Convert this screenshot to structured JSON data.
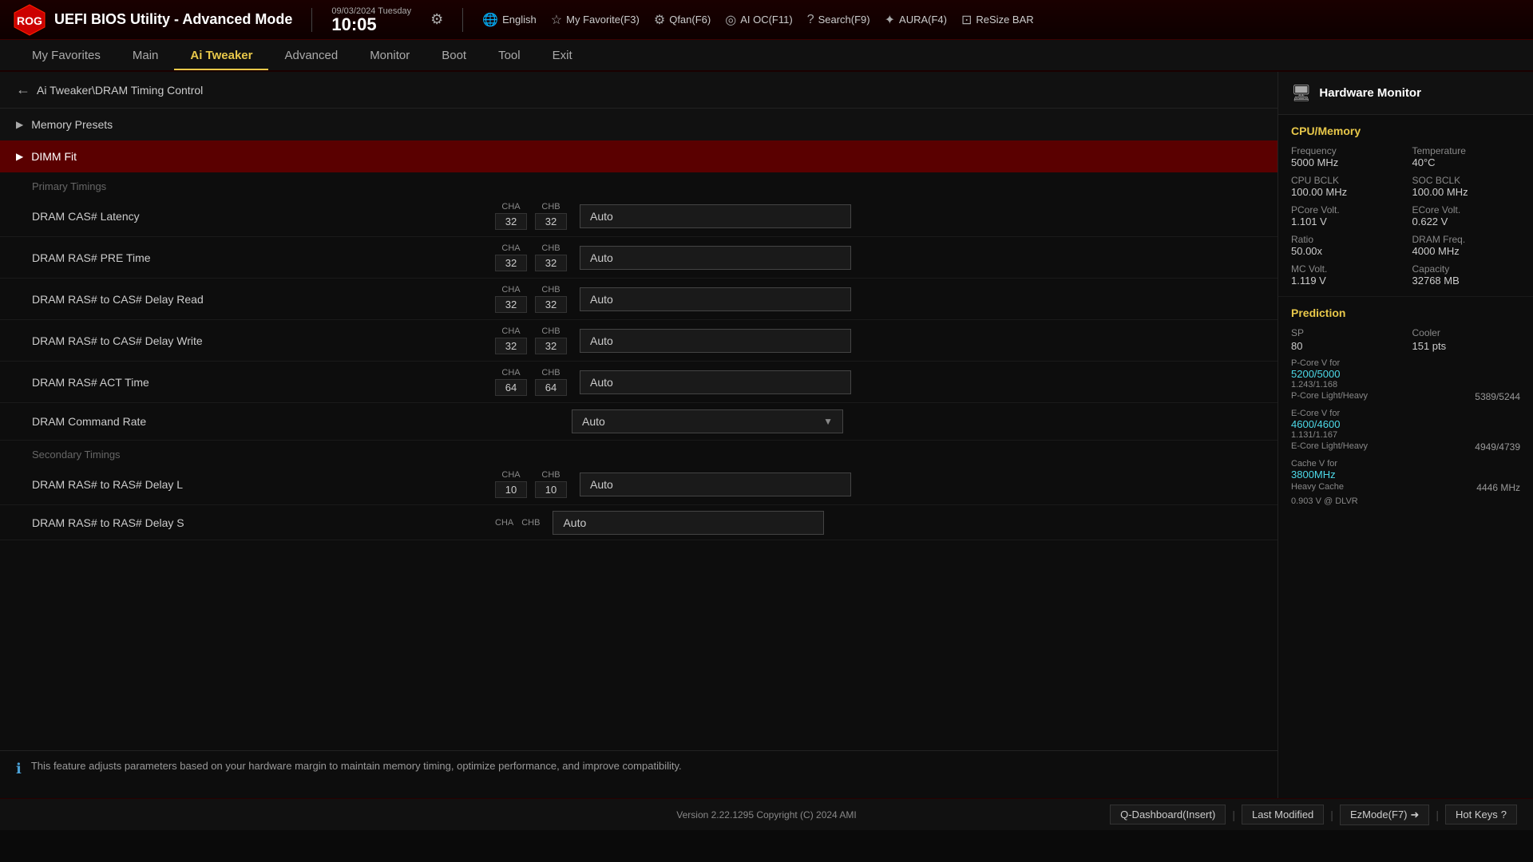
{
  "header": {
    "date": "09/03/2024 Tuesday",
    "time": "10:05",
    "title": "UEFI BIOS Utility - Advanced Mode",
    "tools": [
      {
        "id": "english",
        "icon": "🌐",
        "label": "English"
      },
      {
        "id": "my-favorite",
        "icon": "☆",
        "label": "My Favorite(F3)"
      },
      {
        "id": "qfan",
        "icon": "⚙",
        "label": "Qfan(F6)"
      },
      {
        "id": "ai-oc",
        "icon": "◎",
        "label": "AI OC(F11)"
      },
      {
        "id": "search",
        "icon": "?",
        "label": "Search(F9)"
      },
      {
        "id": "aura",
        "icon": "✦",
        "label": "AURA(F4)"
      },
      {
        "id": "resize-bar",
        "icon": "⊡",
        "label": "ReSize BAR"
      }
    ]
  },
  "nav": {
    "items": [
      {
        "id": "my-favorites",
        "label": "My Favorites",
        "active": false
      },
      {
        "id": "main",
        "label": "Main",
        "active": false
      },
      {
        "id": "ai-tweaker",
        "label": "Ai Tweaker",
        "active": true
      },
      {
        "id": "advanced",
        "label": "Advanced",
        "active": false
      },
      {
        "id": "monitor",
        "label": "Monitor",
        "active": false
      },
      {
        "id": "boot",
        "label": "Boot",
        "active": false
      },
      {
        "id": "tool",
        "label": "Tool",
        "active": false
      },
      {
        "id": "exit",
        "label": "Exit",
        "active": false
      }
    ]
  },
  "breadcrumb": {
    "path": "Ai Tweaker\\DRAM Timing Control"
  },
  "sections": [
    {
      "id": "memory-presets",
      "label": "Memory Presets",
      "expanded": false,
      "active": false
    },
    {
      "id": "dimm-fit",
      "label": "DIMM Fit",
      "expanded": true,
      "active": true
    }
  ],
  "primary_timings_label": "Primary Timings",
  "secondary_timings_label": "Secondary Timings",
  "settings": [
    {
      "id": "dram-cas-latency",
      "name": "DRAM CAS# Latency",
      "cha": "32",
      "chb": "32",
      "value": "Auto",
      "has_arrow": false
    },
    {
      "id": "dram-ras-pre",
      "name": "DRAM RAS# PRE Time",
      "cha": "32",
      "chb": "32",
      "value": "Auto",
      "has_arrow": false
    },
    {
      "id": "dram-ras-cas-read",
      "name": "DRAM RAS# to CAS# Delay Read",
      "cha": "32",
      "chb": "32",
      "value": "Auto",
      "has_arrow": false
    },
    {
      "id": "dram-ras-cas-write",
      "name": "DRAM RAS# to CAS# Delay Write",
      "cha": "32",
      "chb": "32",
      "value": "Auto",
      "has_arrow": false
    },
    {
      "id": "dram-ras-act",
      "name": "DRAM RAS# ACT Time",
      "cha": "64",
      "chb": "64",
      "value": "Auto",
      "has_arrow": false
    },
    {
      "id": "dram-command-rate",
      "name": "DRAM Command Rate",
      "cha": null,
      "chb": null,
      "value": "Auto",
      "has_arrow": true
    }
  ],
  "secondary_settings": [
    {
      "id": "dram-ras-ras-l",
      "name": "DRAM RAS# to RAS# Delay L",
      "cha": "10",
      "chb": "10",
      "value": "Auto",
      "has_arrow": false
    },
    {
      "id": "dram-ras-ras-s",
      "name": "DRAM RAS# to RAS# Delay S",
      "cha": "",
      "chb": "",
      "value": "Auto",
      "has_arrow": false,
      "partial": true
    }
  ],
  "info_text": "This feature adjusts parameters based on your hardware margin to maintain memory timing, optimize performance, and improve compatibility.",
  "hw_monitor": {
    "title": "Hardware Monitor",
    "cpu_memory": {
      "section_title": "CPU/Memory",
      "frequency_label": "Frequency",
      "frequency_value": "5000 MHz",
      "temperature_label": "Temperature",
      "temperature_value": "40°C",
      "cpu_bclk_label": "CPU BCLK",
      "cpu_bclk_value": "100.00 MHz",
      "soc_bclk_label": "SOC BCLK",
      "soc_bclk_value": "100.00 MHz",
      "pcore_volt_label": "PCore Volt.",
      "pcore_volt_value": "1.101 V",
      "ecore_volt_label": "ECore Volt.",
      "ecore_volt_value": "0.622 V",
      "ratio_label": "Ratio",
      "ratio_value": "50.00x",
      "dram_freq_label": "DRAM Freq.",
      "dram_freq_value": "4000 MHz",
      "mc_volt_label": "MC Volt.",
      "mc_volt_value": "1.119 V",
      "capacity_label": "Capacity",
      "capacity_value": "32768 MB"
    },
    "prediction": {
      "section_title": "Prediction",
      "sp_label": "SP",
      "sp_value": "80",
      "cooler_label": "Cooler",
      "cooler_value": "151 pts",
      "pcore_v_for_label": "P-Core V for",
      "pcore_v_for_value_cyan": "5200/5000",
      "pcore_v_for_value": "1.243/1.168",
      "pcore_light_heavy_label": "P-Core Light/Heavy",
      "pcore_light_heavy_value": "5389/5244",
      "ecore_v_for_label": "E-Core V for",
      "ecore_v_for_value_cyan": "4600/4600",
      "ecore_v_for_value": "1.131/1.167",
      "ecore_light_heavy_label": "E-Core Light/Heavy",
      "ecore_light_heavy_value": "4949/4739",
      "cache_v_for_label": "Cache V for",
      "cache_v_for_value_cyan": "3800MHz",
      "cache_heavy_label": "Heavy Cache",
      "cache_heavy_value": "4446 MHz",
      "cache_v_value": "0.903 V @ DLVR"
    }
  },
  "footer": {
    "version": "Version 2.22.1295 Copyright (C) 2024 AMI",
    "qdashboard": "Q-Dashboard(Insert)",
    "last_modified": "Last Modified",
    "ezmode": "EzMode(F7)",
    "hot_keys": "Hot Keys"
  }
}
